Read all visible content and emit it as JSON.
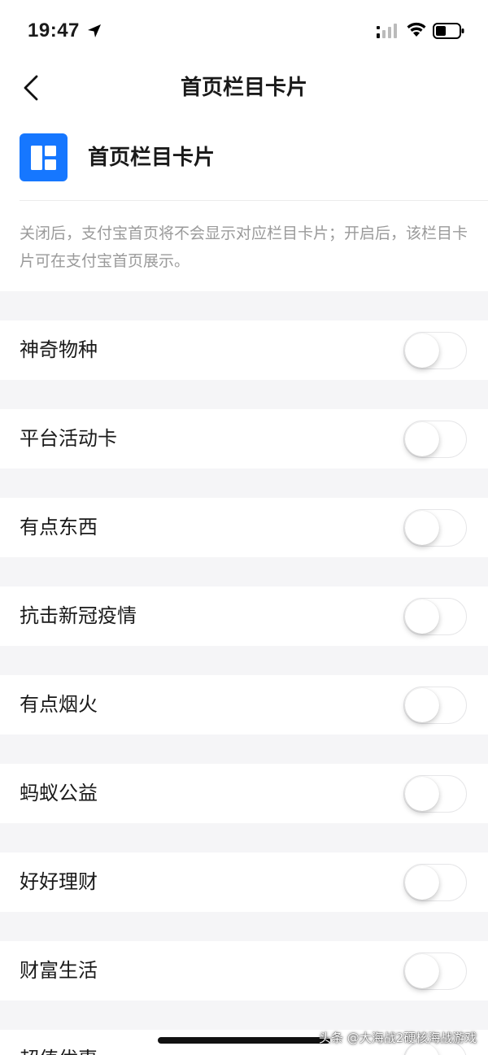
{
  "status_bar": {
    "time": "19:47",
    "icons": [
      "location-arrow-icon",
      "signal-icon",
      "wifi-icon",
      "battery-icon"
    ]
  },
  "nav": {
    "title": "首页栏目卡片",
    "back_icon": "chevron-left-icon"
  },
  "header": {
    "icon": "layout-cards-icon",
    "icon_color": "#1677ff",
    "title": "首页栏目卡片"
  },
  "description": "关闭后，支付宝首页将不会显示对应栏目卡片；开启后，该栏目卡片可在支付宝首页展示。",
  "items": [
    {
      "label": "神奇物种",
      "enabled": false
    },
    {
      "label": "平台活动卡",
      "enabled": false
    },
    {
      "label": "有点东西",
      "enabled": false
    },
    {
      "label": "抗击新冠疫情",
      "enabled": false
    },
    {
      "label": "有点烟火",
      "enabled": false
    },
    {
      "label": "蚂蚁公益",
      "enabled": false
    },
    {
      "label": "好好理财",
      "enabled": false
    },
    {
      "label": "财富生活",
      "enabled": false
    },
    {
      "label": "超值优惠",
      "enabled": false
    }
  ],
  "watermark": "头条 @大海战2硬核海战游戏",
  "colors": {
    "background": "#ffffff",
    "section_gap": "#f5f5f7",
    "accent": "#1677ff",
    "description_text": "#9a9a9a"
  }
}
